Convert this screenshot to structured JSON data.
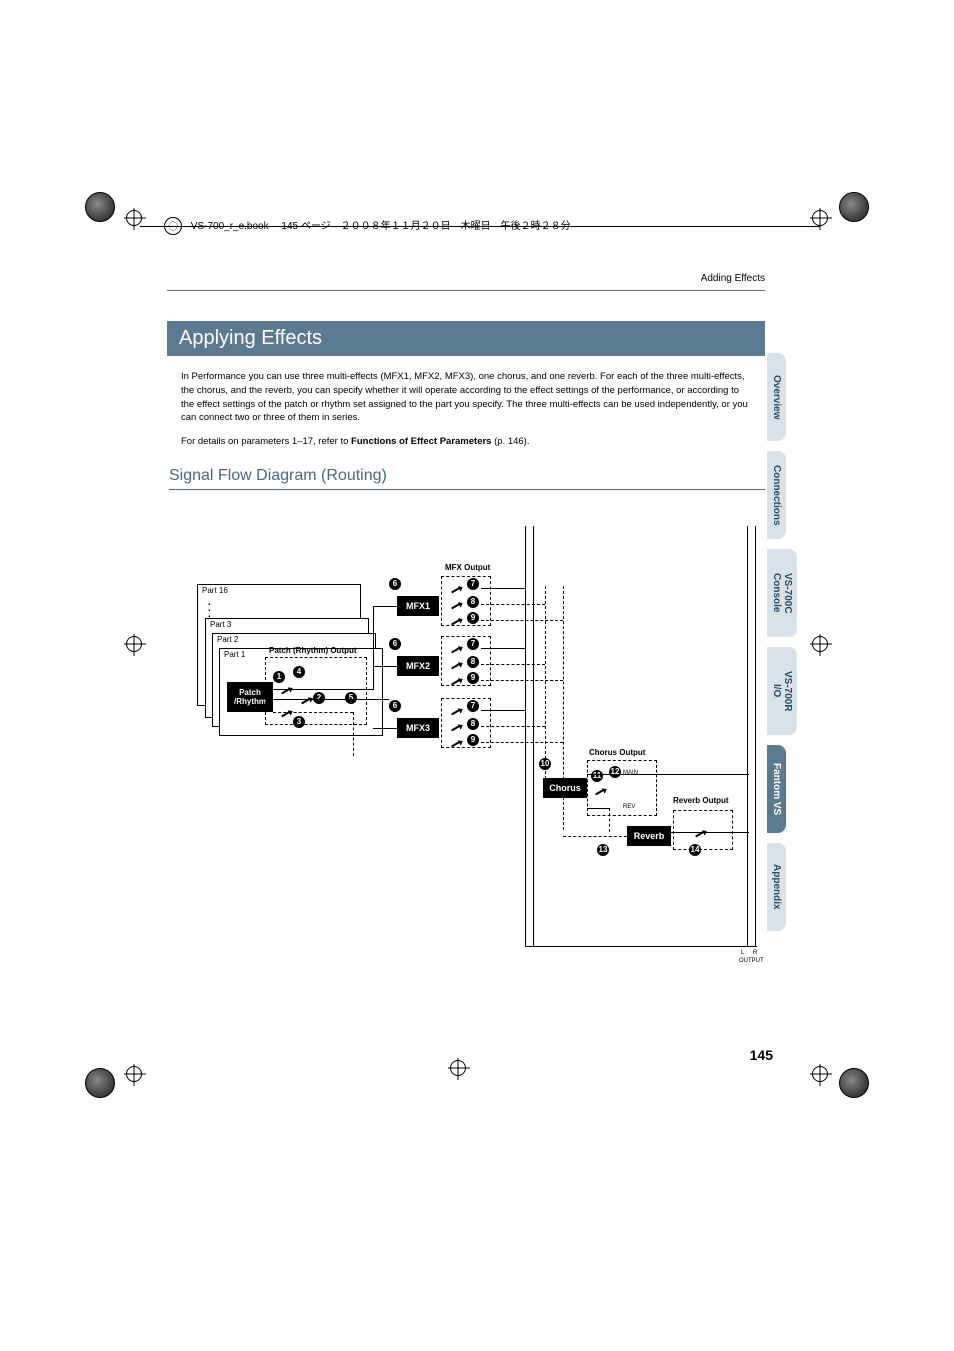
{
  "print_header": {
    "filename": "VS-700_r_e.book",
    "page_text": "145 ページ　２００８年１１月２０日　木曜日　午後２時２８分"
  },
  "running_head": "Adding Effects",
  "section_title": "Applying Effects",
  "paragraphs": {
    "p1": "In Performance you can use three multi-effects (MFX1, MFX2, MFX3), one chorus, and one reverb. For each of the three multi-effects, the chorus, and the reverb, you can specify whether it will operate according to the effect settings of the performance, or according to the effect settings of the patch or rhythm set assigned to the part you specify. The three multi-effects can be used independently, or you can connect two or three of them in series.",
    "p2_pre": "For details on parameters 1–17, refer to ",
    "p2_link": "Functions of Effect Parameters",
    "p2_post": " (p. 146)."
  },
  "subheading": "Signal Flow Diagram (Routing)",
  "side_tabs": [
    {
      "label": "Overview",
      "active": false
    },
    {
      "label": "Connections",
      "active": false
    },
    {
      "label": "VS-700C Console",
      "active": false
    },
    {
      "label": "VS-700R I/O",
      "active": false
    },
    {
      "label": "Fantom VS",
      "active": true
    },
    {
      "label": "Appendix",
      "active": false
    }
  ],
  "page_number": "145",
  "diagram": {
    "parts": {
      "p16": "Part 16",
      "p3": "Part 3",
      "p2": "Part 2",
      "p1": "Part 1"
    },
    "patch_box": "Patch\n/Rhythm",
    "patch_output": "Patch (Rhythm) Output",
    "mfx_output": "MFX Output",
    "mfx1": "MFX1",
    "mfx2": "MFX2",
    "mfx3": "MFX3",
    "chorus": "Chorus",
    "reverb": "Reverb",
    "chorus_output": "Chorus Output",
    "reverb_output": "Reverb Output",
    "main_label": "MAIN",
    "rev_label": "REV",
    "out_L": "L",
    "out_R": "R",
    "output": "OUTPUT",
    "nums": {
      "n1": "1",
      "n2": "2",
      "n3": "3",
      "n4": "4",
      "n5": "5",
      "n6": "6",
      "n7": "7",
      "n8": "8",
      "n9": "9",
      "n10": "10",
      "n11": "11",
      "n12": "12",
      "n13": "13",
      "n14": "14"
    }
  }
}
